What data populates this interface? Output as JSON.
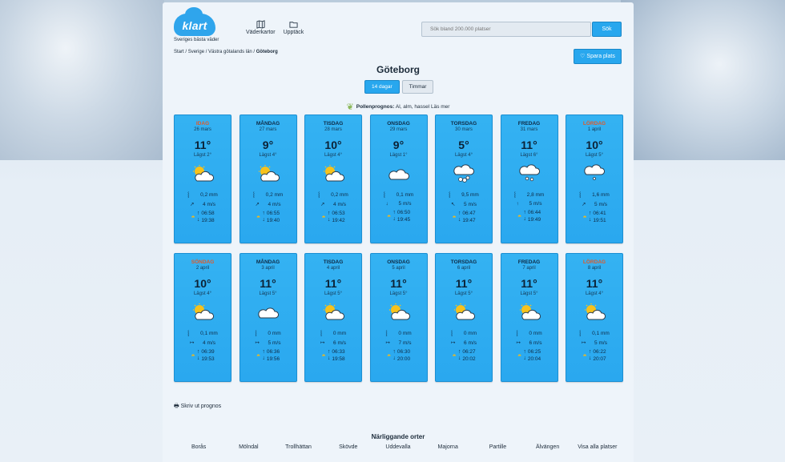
{
  "header": {
    "logo_text": "klart",
    "tagline": "Sveriges bästa väder",
    "nav": [
      {
        "label": "Väderkartor",
        "icon": "map-icon"
      },
      {
        "label": "Upptäck",
        "icon": "folder-icon"
      }
    ],
    "search_placeholder": "Sök bland 200.000 platser",
    "search_button": "Sök"
  },
  "breadcrumb": {
    "home": "Start",
    "country": "Sverige",
    "region": "Västra götalands län",
    "current": "Göteborg",
    "sep": " / "
  },
  "save_button": "Spara plats",
  "city": "Göteborg",
  "tabs": [
    "14 dagar",
    "Timmar"
  ],
  "pollen": {
    "label": "Pollenprognos:",
    "text": "Al, alm, hassel",
    "link": "Läs mer"
  },
  "days": [
    {
      "day": "IDAG",
      "date": "26 mars",
      "temp": "11°",
      "low": "Lägst 2°",
      "icon": "partly-cloudy",
      "rain": "0,2 mm",
      "wind": "4 m/s",
      "wind_dir": "↗",
      "sunrise": "06:58",
      "sunset": "19:38",
      "red": true
    },
    {
      "day": "MÅNDAG",
      "date": "27 mars",
      "temp": "9°",
      "low": "Lägst 4°",
      "icon": "partly-cloudy",
      "rain": "0,2 mm",
      "wind": "4 m/s",
      "wind_dir": "↗",
      "sunrise": "06:55",
      "sunset": "19:40",
      "red": false
    },
    {
      "day": "TISDAG",
      "date": "28 mars",
      "temp": "10°",
      "low": "Lägst 4°",
      "icon": "partly-cloudy",
      "rain": "0,2 mm",
      "wind": "4 m/s",
      "wind_dir": "↗",
      "sunrise": "06:53",
      "sunset": "19:42",
      "red": false
    },
    {
      "day": "ONSDAG",
      "date": "29 mars",
      "temp": "9°",
      "low": "Lägst 1°",
      "icon": "cloudy",
      "rain": "0,1 mm",
      "wind": "5 m/s",
      "wind_dir": "↓",
      "sunrise": "06:50",
      "sunset": "19:45",
      "red": false
    },
    {
      "day": "TORSDAG",
      "date": "30 mars",
      "temp": "5°",
      "low": "Lägst 4°",
      "icon": "heavy-rain",
      "rain": "9,5 mm",
      "wind": "5 m/s",
      "wind_dir": "↖",
      "sunrise": "06:47",
      "sunset": "19:47",
      "red": false
    },
    {
      "day": "FREDAG",
      "date": "31 mars",
      "temp": "11°",
      "low": "Lägst 6°",
      "icon": "rain",
      "rain": "2,8 mm",
      "wind": "5 m/s",
      "wind_dir": "↑",
      "sunrise": "06:44",
      "sunset": "19:49",
      "red": false
    },
    {
      "day": "LÖRDAG",
      "date": "1 april",
      "temp": "10°",
      "low": "Lägst 5°",
      "icon": "light-rain",
      "rain": "1,6 mm",
      "wind": "5 m/s",
      "wind_dir": "↗",
      "sunrise": "06:41",
      "sunset": "19:51",
      "red": true
    },
    {
      "day": "SÖNDAG",
      "date": "2 april",
      "temp": "10°",
      "low": "Lägst 4°",
      "icon": "partly-cloudy",
      "rain": "0,1 mm",
      "wind": "4 m/s",
      "wind_dir": "↦",
      "sunrise": "06:39",
      "sunset": "19:53",
      "red": true
    },
    {
      "day": "MÅNDAG",
      "date": "3 april",
      "temp": "11°",
      "low": "Lägst 5°",
      "icon": "cloudy",
      "rain": "0 mm",
      "wind": "5 m/s",
      "wind_dir": "↦",
      "sunrise": "06:36",
      "sunset": "19:56",
      "red": false
    },
    {
      "day": "TISDAG",
      "date": "4 april",
      "temp": "11°",
      "low": "Lägst 5°",
      "icon": "partly-cloudy",
      "rain": "0 mm",
      "wind": "6 m/s",
      "wind_dir": "↦",
      "sunrise": "06:33",
      "sunset": "19:58",
      "red": false
    },
    {
      "day": "ONSDAG",
      "date": "5 april",
      "temp": "11°",
      "low": "Lägst 5°",
      "icon": "partly-cloudy",
      "rain": "0 mm",
      "wind": "7 m/s",
      "wind_dir": "↦",
      "sunrise": "06:30",
      "sunset": "20:00",
      "red": false
    },
    {
      "day": "TORSDAG",
      "date": "6 april",
      "temp": "11°",
      "low": "Lägst 5°",
      "icon": "partly-cloudy",
      "rain": "0 mm",
      "wind": "6 m/s",
      "wind_dir": "↦",
      "sunrise": "06:27",
      "sunset": "20:02",
      "red": false
    },
    {
      "day": "FREDAG",
      "date": "7 april",
      "temp": "11°",
      "low": "Lägst 5°",
      "icon": "partly-cloudy",
      "rain": "0 mm",
      "wind": "6 m/s",
      "wind_dir": "↦",
      "sunrise": "06:25",
      "sunset": "20:04",
      "red": false
    },
    {
      "day": "LÖRDAG",
      "date": "8 april",
      "temp": "11°",
      "low": "Lägst 4°",
      "icon": "partly-cloudy",
      "rain": "0,1 mm",
      "wind": "5 m/s",
      "wind_dir": "↦",
      "sunrise": "06:22",
      "sunset": "20:07",
      "red": true
    }
  ],
  "print_label": "Skriv ut prognos",
  "nearby": {
    "title": "Närliggande orter",
    "places": [
      "Borås",
      "Mölndal",
      "Trollhättan",
      "Skövde",
      "Uddevalla",
      "Majorna",
      "Partille",
      "Älvängen",
      "Visa alla platser"
    ]
  },
  "colors": {
    "accent": "#28a7ee",
    "card": "#2faef1",
    "weekend_day": "#e05a2a",
    "sun": "#f2b91a"
  }
}
